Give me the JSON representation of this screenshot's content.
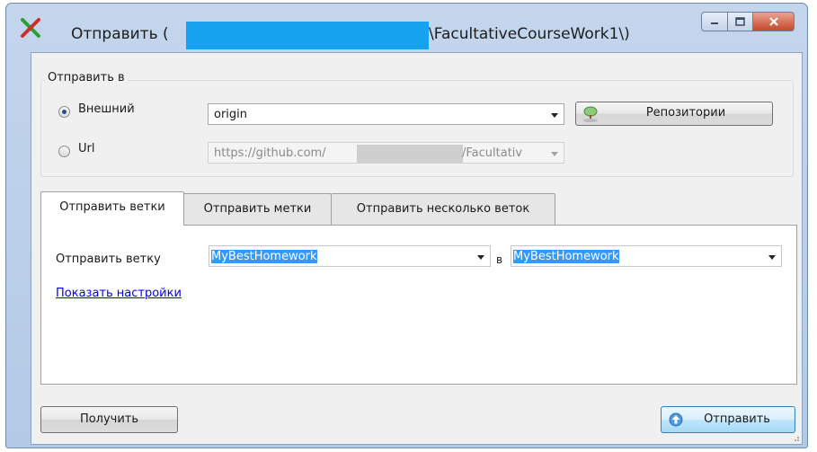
{
  "window": {
    "title_start": "Отправить (",
    "title_end": "\\FacultativeCourseWork1\\)",
    "app_icon": "git-extensions-x-icon",
    "controls": [
      "minimize-icon",
      "maximize-icon",
      "close-icon"
    ]
  },
  "push_to": {
    "group_label": "Отправить в",
    "remote_option": {
      "label": "Внешний",
      "checked": true
    },
    "remote_value": "origin",
    "remotes_button": "Репозитории",
    "url_option": {
      "label": "Url",
      "checked": false
    },
    "url_value_start": "https://github.com/",
    "url_value_end": "/Facultativ"
  },
  "tabs": [
    {
      "label": "Отправить ветки",
      "active": true
    },
    {
      "label": "Отправить метки",
      "active": false
    },
    {
      "label": "Отправить несколько веток",
      "active": false
    }
  ],
  "branch_tab": {
    "branch_label": "Отправить ветку",
    "local_branch": "MyBestHomework",
    "to_label": "в",
    "remote_branch": "MyBestHomework",
    "options_link": "Показать настройки"
  },
  "footer": {
    "pull_button": "Получить",
    "push_button": "Отправить"
  },
  "colors": {
    "title_redaction": "#15a3f0",
    "selection": "#3399ff",
    "link": "#0000ee"
  }
}
